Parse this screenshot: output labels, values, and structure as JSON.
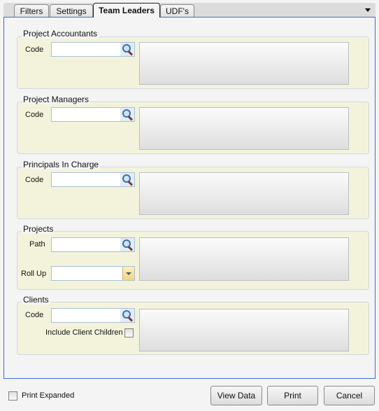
{
  "tabs": [
    {
      "label": "Filters"
    },
    {
      "label": "Settings"
    },
    {
      "label": "Team Leaders",
      "active": true
    },
    {
      "label": "UDF's"
    }
  ],
  "groups": {
    "project_accountants": {
      "title": "Project Accountants",
      "code_label": "Code",
      "code_value": ""
    },
    "project_managers": {
      "title": "Project Managers",
      "code_label": "Code",
      "code_value": ""
    },
    "principals_in_charge": {
      "title": "Principals In Charge",
      "code_label": "Code",
      "code_value": ""
    },
    "projects": {
      "title": "Projects",
      "path_label": "Path",
      "path_value": "",
      "rollup_label": "Roll Up",
      "rollup_value": ""
    },
    "clients": {
      "title": "Clients",
      "code_label": "Code",
      "code_value": "",
      "include_children_label": "Include Client Children",
      "include_children_checked": false
    }
  },
  "footer": {
    "print_expanded_label": "Print Expanded",
    "print_expanded_checked": false,
    "view_data": "View Data",
    "print": "Print",
    "cancel": "Cancel"
  },
  "colors": {
    "panel_border": "#3a6fd0",
    "group_bg": "#f3f3dc"
  }
}
